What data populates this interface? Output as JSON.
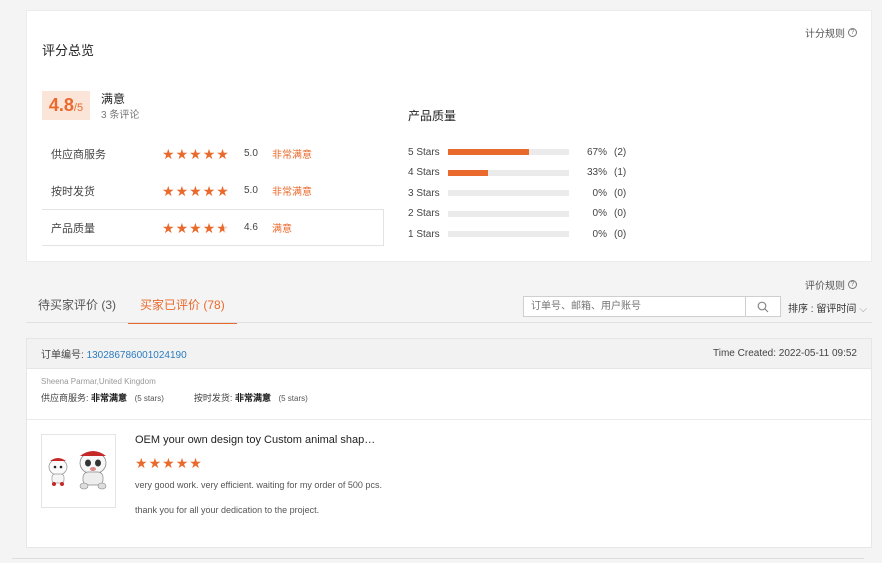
{
  "summary": {
    "title": "评分总览",
    "rules_link": "计分规则",
    "score": "4.8",
    "score_max": "/5",
    "overall_label": "满意",
    "review_count": "3 条评论",
    "rows": [
      {
        "label": "供应商服务",
        "stars": 5,
        "value": "5.0",
        "desc": "非常满意"
      },
      {
        "label": "按时发货",
        "stars": 5,
        "value": "5.0",
        "desc": "非常满意"
      },
      {
        "label": "产品质量",
        "stars": 4.6,
        "value": "4.6",
        "desc": "满意"
      }
    ]
  },
  "quality": {
    "title": "产品质量",
    "distribution": [
      {
        "label": "5 Stars",
        "percent": 67,
        "percent_text": "67%",
        "count": "(2)"
      },
      {
        "label": "4 Stars",
        "percent": 33,
        "percent_text": "33%",
        "count": "(1)"
      },
      {
        "label": "3 Stars",
        "percent": 0,
        "percent_text": "0%",
        "count": "(0)"
      },
      {
        "label": "2 Stars",
        "percent": 0,
        "percent_text": "0%",
        "count": "(0)"
      },
      {
        "label": "1 Stars",
        "percent": 0,
        "percent_text": "0%",
        "count": "(0)"
      }
    ]
  },
  "reviews_header": {
    "rules_link": "评价规则",
    "tabs": [
      {
        "label": "待买家评价 (3)",
        "active": false
      },
      {
        "label": "买家已评价 (78)",
        "active": true
      }
    ],
    "search_placeholder": "订单号、邮箱、用户账号",
    "sort_label": "排序 : 留评时间"
  },
  "order": {
    "order_no_label": "订单编号:",
    "order_no": "130286786001024190",
    "time_created": "Time Created: 2022-05-11 09:52",
    "buyer": "Sheena Parmar,United Kingdom",
    "supplier_service_label": "供应商服务:",
    "supplier_service_value": "非常满意",
    "supplier_service_stars": "(5 stars)",
    "delivery_label": "按时发货:",
    "delivery_value": "非常满意",
    "delivery_stars": "(5 stars)",
    "product_title": "OEM your own design toy Custom animal shap…",
    "review_stars": 5,
    "review_line1": "very good work. very efficient. waiting for my order of 500 pcs.",
    "review_line2": "thank you for all your dedication to the project."
  },
  "colors": {
    "accent": "#e96a2c",
    "link": "#2b7bc0"
  }
}
